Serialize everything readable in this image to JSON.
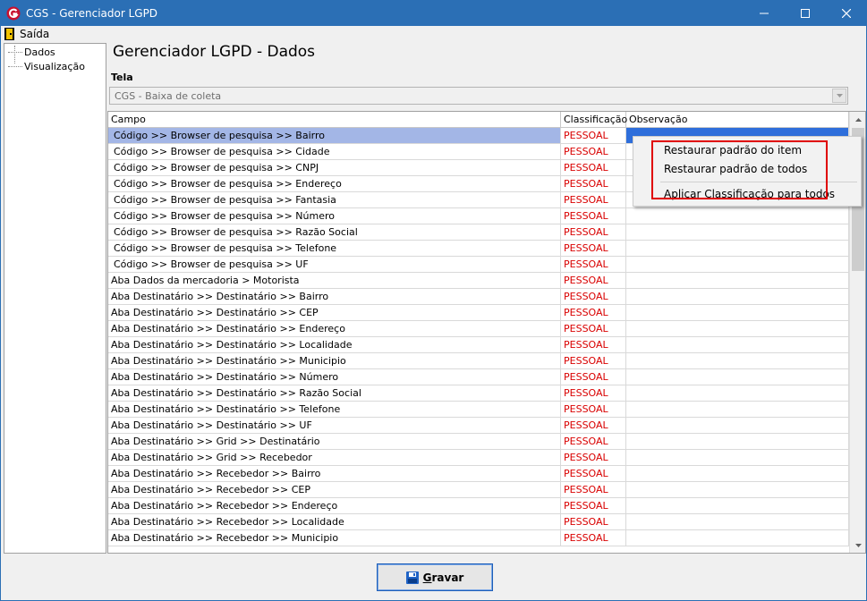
{
  "window": {
    "title": "CGS - Gerenciador LGPD"
  },
  "menu": {
    "exit_label": "Saída"
  },
  "tree": {
    "items": [
      "Dados",
      "Visualização"
    ]
  },
  "main": {
    "heading": "Gerenciador LGPD - Dados",
    "tela_label": "Tela",
    "tela_value": "CGS - Baixa de coleta"
  },
  "grid": {
    "columns": [
      "Campo",
      "Classificação",
      "Observação"
    ],
    "rows": [
      [
        "Código >> Browser de pesquisa >> Bairro",
        "PESSOAL",
        ""
      ],
      [
        "Código >> Browser de pesquisa >> Cidade",
        "PESSOAL",
        ""
      ],
      [
        "Código >> Browser de pesquisa >> CNPJ",
        "PESSOAL",
        ""
      ],
      [
        "Código >> Browser de pesquisa >> Endereço",
        "PESSOAL",
        ""
      ],
      [
        "Código >> Browser de pesquisa >> Fantasia",
        "PESSOAL",
        ""
      ],
      [
        "Código >> Browser de pesquisa >> Número",
        "PESSOAL",
        ""
      ],
      [
        "Código >> Browser de pesquisa >> Razão Social",
        "PESSOAL",
        ""
      ],
      [
        "Código >> Browser de pesquisa >> Telefone",
        "PESSOAL",
        ""
      ],
      [
        "Código >> Browser de pesquisa >> UF",
        "PESSOAL",
        ""
      ],
      [
        "Aba Dados da mercadoria > Motorista",
        "PESSOAL",
        ""
      ],
      [
        "Aba Destinatário >> Destinatário >> Bairro",
        "PESSOAL",
        ""
      ],
      [
        "Aba Destinatário >> Destinatário >> CEP",
        "PESSOAL",
        ""
      ],
      [
        "Aba Destinatário >> Destinatário >> Endereço",
        "PESSOAL",
        ""
      ],
      [
        "Aba Destinatário >> Destinatário >> Localidade",
        "PESSOAL",
        ""
      ],
      [
        "Aba Destinatário >> Destinatário >> Municipio",
        "PESSOAL",
        ""
      ],
      [
        "Aba Destinatário >> Destinatário >> Número",
        "PESSOAL",
        ""
      ],
      [
        "Aba Destinatário >> Destinatário >> Razão Social",
        "PESSOAL",
        ""
      ],
      [
        "Aba Destinatário >> Destinatário >> Telefone",
        "PESSOAL",
        ""
      ],
      [
        "Aba Destinatário >> Destinatário >> UF",
        "PESSOAL",
        ""
      ],
      [
        "Aba Destinatário >> Grid >> Destinatário",
        "PESSOAL",
        ""
      ],
      [
        "Aba Destinatário >> Grid >> Recebedor",
        "PESSOAL",
        ""
      ],
      [
        "Aba Destinatário >> Recebedor >> Bairro",
        "PESSOAL",
        ""
      ],
      [
        "Aba Destinatário >> Recebedor >> CEP",
        "PESSOAL",
        ""
      ],
      [
        "Aba Destinatário >> Recebedor >> Endereço",
        "PESSOAL",
        ""
      ],
      [
        "Aba Destinatário >> Recebedor >> Localidade",
        "PESSOAL",
        ""
      ],
      [
        "Aba Destinatário >> Recebedor >> Municipio",
        "PESSOAL",
        ""
      ]
    ]
  },
  "context_menu": {
    "items": [
      "Restaurar padrão do item",
      "Restaurar padrão de todos",
      "Aplicar Classificação para todos"
    ]
  },
  "footer": {
    "save_label_first": "G",
    "save_label_rest": "ravar"
  },
  "colors": {
    "titlebar": "#2b6fb5",
    "classification_text": "#d90000",
    "selection": "#a3b6e6",
    "highlight": "#e00000"
  }
}
